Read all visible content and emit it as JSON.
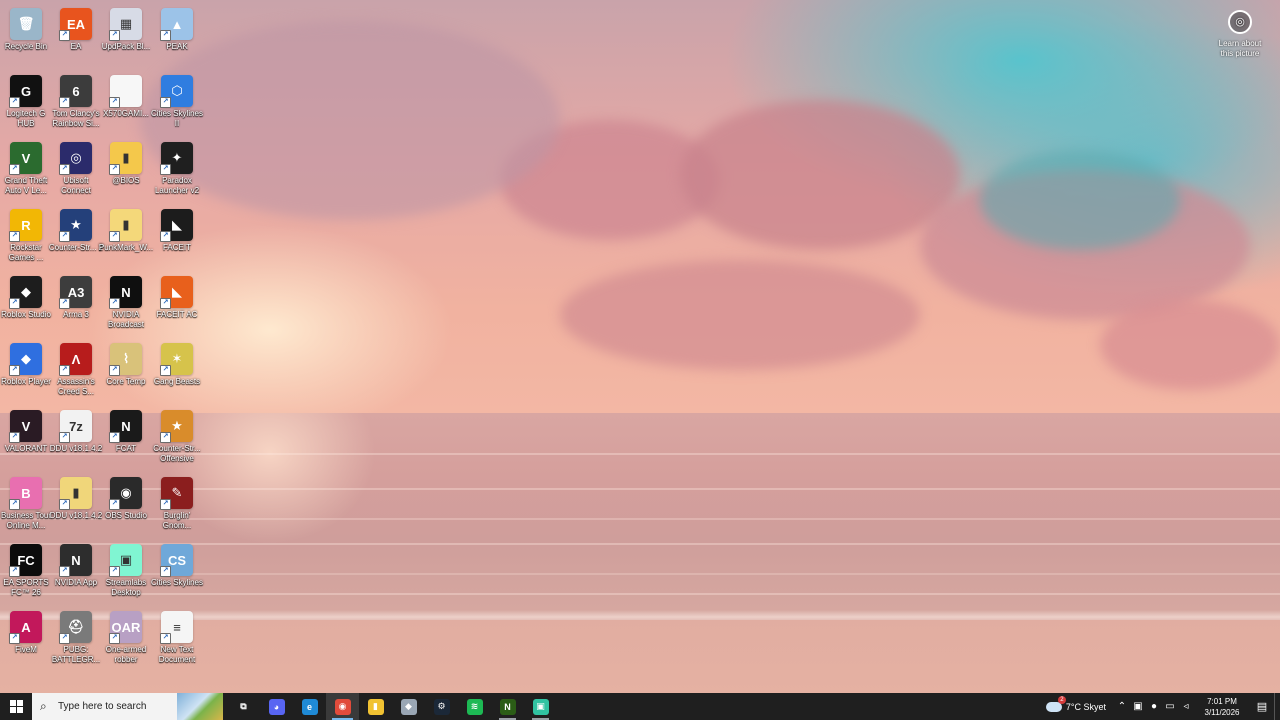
{
  "wallpaper": {
    "learn_label": "Learn about this picture",
    "learn_icon": "camera-icon"
  },
  "desktop_icons": [
    {
      "label": "Recycle Bin",
      "icon": "recycle-bin-icon",
      "color": "#9ab6c9",
      "glyph": "🗑"
    },
    {
      "label": "Logitech G HUB",
      "icon": "logitech-ghub-icon",
      "color": "#111111",
      "glyph": "G"
    },
    {
      "label": "Grand Theft Auto V Le...",
      "icon": "gta-v-icon",
      "color": "#2b6b2f",
      "glyph": "V"
    },
    {
      "label": "Rockstar Games ...",
      "icon": "rockstar-icon",
      "color": "#f2b705",
      "glyph": "R"
    },
    {
      "label": "Roblox Studio",
      "icon": "roblox-studio-icon",
      "color": "#1d1d1d",
      "glyph": "◆"
    },
    {
      "label": "Roblox Player",
      "icon": "roblox-player-icon",
      "color": "#2f6fe0",
      "glyph": "◆"
    },
    {
      "label": "VALORANT",
      "icon": "valorant-icon",
      "color": "#2a1b24",
      "glyph": "V"
    },
    {
      "label": "Business Tour Online M...",
      "icon": "business-tour-icon",
      "color": "#e86fb0",
      "glyph": "B"
    },
    {
      "label": "EA SPORTS FC™ 26",
      "icon": "ea-fc-icon",
      "color": "#0c0c0c",
      "glyph": "FC"
    },
    {
      "label": "FiveM",
      "icon": "fivem-icon",
      "color": "#c2185b",
      "glyph": "A"
    },
    {
      "label": "EA",
      "icon": "ea-icon",
      "color": "#e8541e",
      "glyph": "EA"
    },
    {
      "label": "Tom Clancy's Rainbow Si...",
      "icon": "rainbow-six-icon",
      "color": "#3c3c3c",
      "glyph": "6"
    },
    {
      "label": "Ubisoft Connect",
      "icon": "ubisoft-connect-icon",
      "color": "#2b2b6b",
      "glyph": "◎"
    },
    {
      "label": "Counter-Str... 2",
      "icon": "cs2-icon",
      "color": "#24407a",
      "glyph": "★"
    },
    {
      "label": "Arma 3",
      "icon": "arma3-icon",
      "color": "#3d3d3d",
      "glyph": "A3"
    },
    {
      "label": "Assassin's Creed S...",
      "icon": "assassins-creed-icon",
      "color": "#b71c1c",
      "glyph": "Λ"
    },
    {
      "label": "DDU v18.1.4.2",
      "icon": "ddu-7z-icon",
      "color": "#f2f2f2",
      "glyph": "7z"
    },
    {
      "label": "DDU v18.1.4.2",
      "icon": "ddu-folder-icon",
      "color": "#f0d67a",
      "glyph": "▮"
    },
    {
      "label": "NVIDIA App",
      "icon": "nvidia-app-icon",
      "color": "#2d2d2d",
      "glyph": "N"
    },
    {
      "label": "PUBG: BATTLEGR...",
      "icon": "pubg-icon",
      "color": "#7a7a7a",
      "glyph": "⛑"
    },
    {
      "label": "UpdPack Bl...",
      "icon": "updpack-icon",
      "color": "#d7dbe6",
      "glyph": "▦"
    },
    {
      "label": "X570GAMI...",
      "icon": "file-icon",
      "color": "#f7f7f7",
      "glyph": ""
    },
    {
      "label": "@BIOS",
      "icon": "folder-icon",
      "color": "#f4c84b",
      "glyph": "▮"
    },
    {
      "label": "PunkMark_W...",
      "icon": "zip-folder-icon",
      "color": "#f4d87a",
      "glyph": "▮"
    },
    {
      "label": "NVIDIA Broadcast",
      "icon": "nvidia-broadcast-icon",
      "color": "#0f0f0f",
      "glyph": "N"
    },
    {
      "label": "Core Temp",
      "icon": "core-temp-icon",
      "color": "#d9c27a",
      "glyph": "⌇"
    },
    {
      "label": "FCAT",
      "icon": "fcat-icon",
      "color": "#1a1a1a",
      "glyph": "N"
    },
    {
      "label": "OBS Studio",
      "icon": "obs-icon",
      "color": "#2a2a2a",
      "glyph": "◉"
    },
    {
      "label": "Streamlabs Desktop",
      "icon": "streamlabs-icon",
      "color": "#80f5d2",
      "glyph": "▣"
    },
    {
      "label": "One-armed robber",
      "icon": "one-armed-robber-icon",
      "color": "#b8a0c4",
      "glyph": "OAR"
    },
    {
      "label": "PEAK",
      "icon": "peak-icon",
      "color": "#9cc3e8",
      "glyph": "▲"
    },
    {
      "label": "Cities Skylines II",
      "icon": "cities-skylines-2-icon",
      "color": "#2f7de0",
      "glyph": "⬡"
    },
    {
      "label": "Paradox Launcher v2",
      "icon": "paradox-launcher-icon",
      "color": "#1f1f1f",
      "glyph": "✦"
    },
    {
      "label": "FACEIT",
      "icon": "faceit-icon",
      "color": "#1c1c1c",
      "glyph": "◣"
    },
    {
      "label": "FACEIT AC",
      "icon": "faceit-ac-icon",
      "color": "#e8601c",
      "glyph": "◣"
    },
    {
      "label": "Gang Beasts",
      "icon": "gang-beasts-icon",
      "color": "#d6c34b",
      "glyph": "✶"
    },
    {
      "label": "Counter-Str... Offensive",
      "icon": "csgo-icon",
      "color": "#d98c2b",
      "glyph": "★"
    },
    {
      "label": "Burglin' Gnom...",
      "icon": "burglin-gnomes-icon",
      "color": "#8b1e1e",
      "glyph": "✎"
    },
    {
      "label": "Cities Skylines",
      "icon": "cities-skylines-icon",
      "color": "#6fa8d9",
      "glyph": "CS"
    },
    {
      "label": "New Text Document",
      "icon": "text-document-icon",
      "color": "#f5f5f5",
      "glyph": "≡"
    }
  ],
  "taskbar": {
    "search_placeholder": "Type here to search",
    "search_icon": "search-icon",
    "apps": [
      {
        "name": "task-view",
        "icon": "task-view-icon",
        "glyph": "⧉",
        "color": "transparent",
        "state": ""
      },
      {
        "name": "discord",
        "icon": "discord-icon",
        "glyph": "◕",
        "color": "#5865f2",
        "state": ""
      },
      {
        "name": "edge",
        "icon": "edge-icon",
        "glyph": "e",
        "color": "#1f8ad6",
        "state": ""
      },
      {
        "name": "chrome",
        "icon": "chrome-icon",
        "glyph": "◉",
        "color": "#e14b3b",
        "state": "active"
      },
      {
        "name": "file-explorer",
        "icon": "file-explorer-icon",
        "glyph": "▮",
        "color": "#f1c232",
        "state": ""
      },
      {
        "name": "unknown-app",
        "icon": "app-icon",
        "glyph": "◆",
        "color": "#9aa7b5",
        "state": ""
      },
      {
        "name": "steam",
        "icon": "steam-icon",
        "glyph": "⚙",
        "color": "#1b2838",
        "state": ""
      },
      {
        "name": "spotify",
        "icon": "spotify-icon",
        "glyph": "≋",
        "color": "#1db954",
        "state": ""
      },
      {
        "name": "nvidia",
        "icon": "nvidia-icon",
        "glyph": "N",
        "color": "#2b5d16",
        "state": "open"
      },
      {
        "name": "streamlabs",
        "icon": "streamlabs-icon",
        "glyph": "▣",
        "color": "#31c3a2",
        "state": "open"
      }
    ],
    "weather_text": "7°C  Skyet",
    "clock_time": "7:01 PM",
    "clock_date": "3/11/2026"
  }
}
